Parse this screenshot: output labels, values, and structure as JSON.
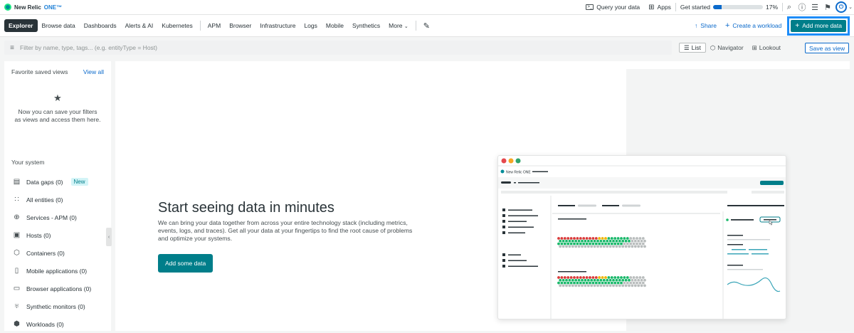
{
  "brand": {
    "name": "New Relic",
    "suffix": "ONE™"
  },
  "topbar": {
    "query_label": "Query your data",
    "apps_label": "Apps",
    "get_started_label": "Get started",
    "progress_percent": 17,
    "progress_text": "17%"
  },
  "nav": {
    "tabs": [
      "Explorer",
      "Browse data",
      "Dashboards",
      "Alerts & AI",
      "Kubernetes",
      "APM",
      "Browser",
      "Infrastructure",
      "Logs",
      "Mobile",
      "Synthetics",
      "More"
    ],
    "share_label": "Share",
    "create_workload_label": "Create a workload",
    "add_more_label": "Add more data"
  },
  "filter": {
    "placeholder": "Filter by name, type, tags... (e.g. entityType = Host)"
  },
  "views": {
    "list_label": "List",
    "navigator_label": "Navigator",
    "lookout_label": "Lookout",
    "save_as_view_label": "Save as view"
  },
  "sidebar": {
    "favorites_title": "Favorite saved views",
    "view_all_label": "View all",
    "empty_message": "Now you can save your filters as views and access them here.",
    "your_system_title": "Your system",
    "items": [
      {
        "label": "Data gaps (0)",
        "icon": "data-gaps-icon",
        "badge": "New"
      },
      {
        "label": "All entities (0)",
        "icon": "grid-icon"
      },
      {
        "label": "Services - APM (0)",
        "icon": "globe-icon"
      },
      {
        "label": "Hosts (0)",
        "icon": "server-icon"
      },
      {
        "label": "Containers (0)",
        "icon": "cube-icon"
      },
      {
        "label": "Mobile applications (0)",
        "icon": "mobile-icon"
      },
      {
        "label": "Browser applications (0)",
        "icon": "browser-icon"
      },
      {
        "label": "Synthetic monitors (0)",
        "icon": "monitor-icon"
      },
      {
        "label": "Workloads (0)",
        "icon": "workload-icon"
      }
    ]
  },
  "hero": {
    "title": "Start seeing data in minutes",
    "description": "We can bring your data together from across your entire technology stack (including metrics, events, logs, and traces). Get all your data at your fingertips to find the root cause of problems and optimize your systems.",
    "button_label": "Add some data"
  },
  "mock_brand": "New Relic ONE",
  "colors": {
    "accent": "#007e8a",
    "link": "#0b6acb",
    "highlight": "#1d8cf8",
    "status_red": "#d93a3a",
    "status_yellow": "#f0b400",
    "status_green": "#19b86a",
    "status_gray": "#b9bdbd"
  }
}
